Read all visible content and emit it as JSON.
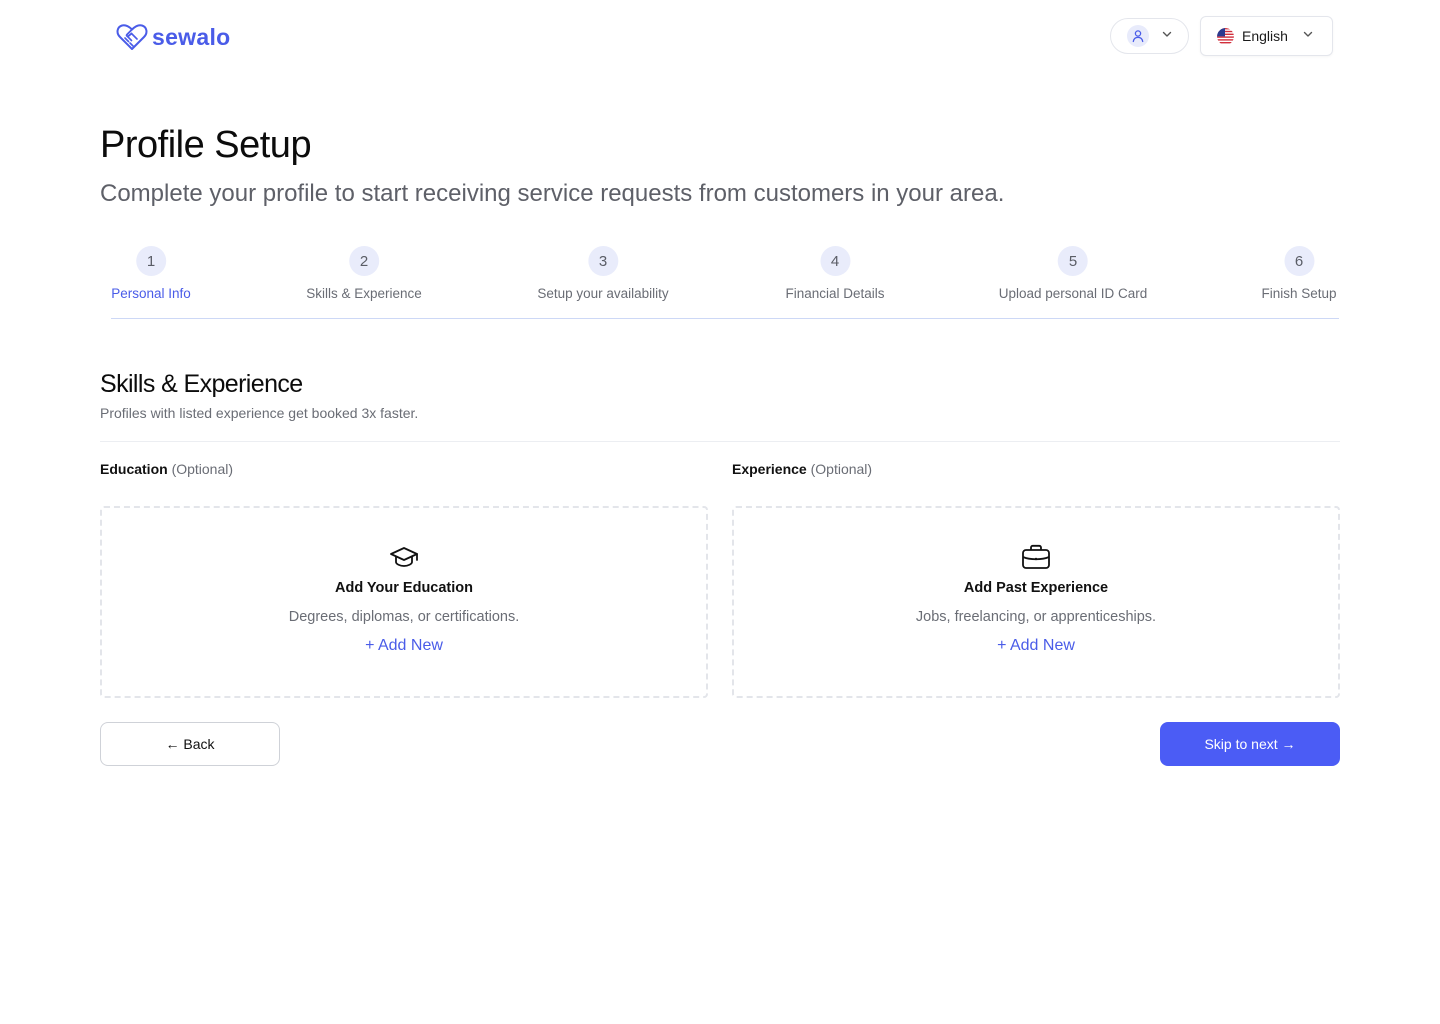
{
  "brand": {
    "name": "sewalo",
    "logo_icon": "handshake-heart-icon",
    "color": "#4a5ce8"
  },
  "header": {
    "user_icon": "user-icon",
    "language": {
      "label": "English",
      "flag_icon": "us-flag-icon"
    }
  },
  "page": {
    "title": "Profile Setup",
    "subtitle": "Complete your profile to start receiving service requests from customers in your area."
  },
  "stepper": {
    "steps": [
      {
        "number": "1",
        "label": "Personal Info",
        "active": true
      },
      {
        "number": "2",
        "label": "Skills & Experience",
        "active": false
      },
      {
        "number": "3",
        "label": "Setup your availability",
        "active": false
      },
      {
        "number": "4",
        "label": "Financial Details",
        "active": false
      },
      {
        "number": "5",
        "label": "Upload personal ID Card",
        "active": false
      },
      {
        "number": "6",
        "label": "Finish Setup",
        "active": false
      }
    ]
  },
  "section": {
    "title": "Skills & Experience",
    "subtitle": "Profiles with listed experience get booked 3x faster."
  },
  "education": {
    "label": "Education",
    "optional": "(Optional)",
    "icon": "graduation-cap-icon",
    "title": "Add Your Education",
    "description": "Degrees, diplomas, or certifications.",
    "add_label": "+ Add New"
  },
  "experience": {
    "label": "Experience",
    "optional": "(Optional)",
    "icon": "briefcase-icon",
    "title": "Add Past Experience",
    "description": "Jobs, freelancing, or apprenticeships.",
    "add_label": "+ Add New"
  },
  "actions": {
    "back_label": "← Back",
    "next_label": "Skip to next →",
    "primary_color": "#4b5cf5"
  }
}
